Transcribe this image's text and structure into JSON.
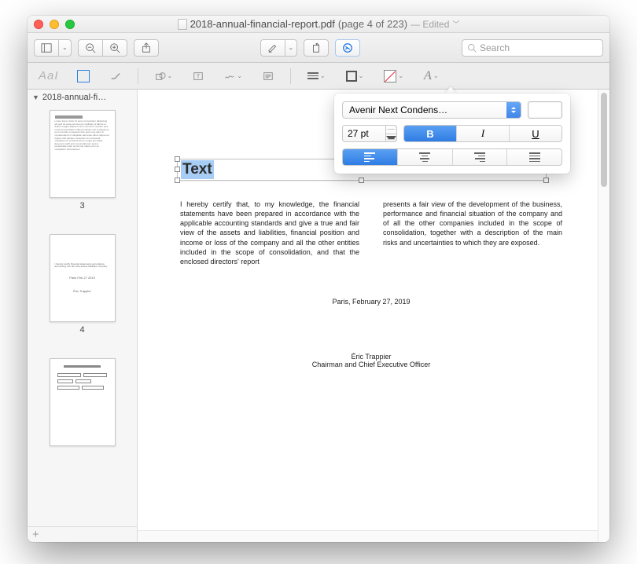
{
  "window": {
    "filename": "2018-annual-financial-report.pdf",
    "page_info": "(page 4 of 223)",
    "edited_label": "— Edited"
  },
  "toolbar": {
    "search_placeholder": "Search"
  },
  "sidebar": {
    "doc_label": "2018-annual-fi…",
    "pages": [
      {
        "num": "3"
      },
      {
        "num": "4"
      },
      {
        "num": ""
      }
    ],
    "add_label": "+"
  },
  "textbox": {
    "value": "Text"
  },
  "doc": {
    "col1": "I hereby certify that, to my knowledge, the financial statements have been prepared in accordance with the applicable accounting standards and give a true and fair view of the assets and liabilities, financial position and income or loss of the company and all the other entities included in the scope of consolidation, and that the enclosed directors' report",
    "col2": "presents a fair view of the development of the business, performance and financial situation of the company and of all the other companies included in the scope of consolidation, together with a description of the main risks and uncertainties to which they are exposed.",
    "placeline": "Paris, February 27, 2019",
    "signer_name": "Éric Trappier",
    "signer_title": "Chairman and Chief Executive Officer"
  },
  "popover": {
    "font_name": "Avenir Next Condens…",
    "font_size": "27 pt",
    "bold": "B",
    "italic": "I",
    "underline": "U",
    "color": "#ffffff"
  }
}
